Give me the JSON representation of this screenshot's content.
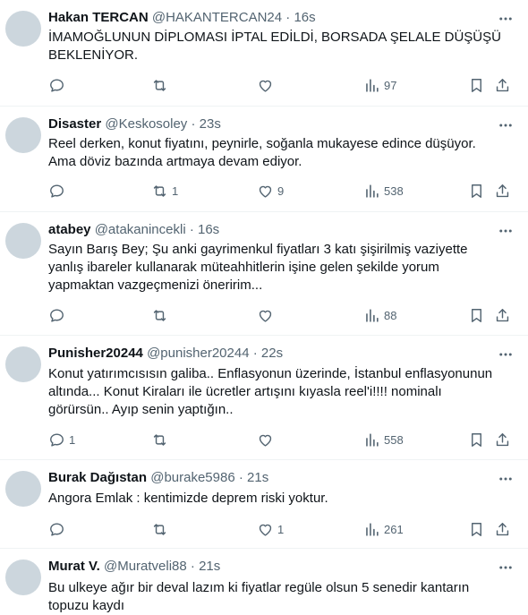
{
  "tweets": [
    {
      "name": "Hakan TERCAN",
      "handle": "@HAKANTERCAN24",
      "sep": "·",
      "time": "16s",
      "lines": [
        "İMAMOĞLUNUN DİPLOMASI İPTAL EDİLDİ, BORSADA ŞELALE DÜŞÜŞÜ",
        "BEKLENİYOR."
      ],
      "replies": "",
      "retweets": "",
      "likes": "",
      "views": "97"
    },
    {
      "name": "Disaster",
      "handle": "@Keskosoley",
      "sep": "·",
      "time": "23s",
      "lines": [
        "Reel derken, konut fiyatını, peynirle, soğanla mukayese edince düşüyor.",
        "Ama döviz bazında artmaya devam ediyor."
      ],
      "replies": "",
      "retweets": "1",
      "likes": "9",
      "views": "538"
    },
    {
      "name": "atabey",
      "handle": "@atakanincekli",
      "sep": "·",
      "time": "16s",
      "lines": [
        "Sayın Barış Bey; Şu anki gayrimenkul fiyatları 3 katı şişirilmiş vaziyette",
        "yanlış ibareler kullanarak müteahhitlerin işine gelen şekilde yorum",
        "yapmaktan vazgeçmenizi öneririm..."
      ],
      "replies": "",
      "retweets": "",
      "likes": "",
      "views": "88"
    },
    {
      "name": "Punisher20244",
      "handle": "@punisher20244",
      "sep": "·",
      "time": "22s",
      "lines": [
        "Konut yatırımcısısın galiba.. Enflasyonun üzerinde, İstanbul enflasyonunun",
        "altında... Konut Kiraları ile ücretler artışını kıyasla reel'i!!!! nominalı",
        "görürsün.. Ayıp senin yaptığın.."
      ],
      "replies": "1",
      "retweets": "",
      "likes": "",
      "views": "558"
    },
    {
      "name": "Burak Dağıstan",
      "handle": "@burake5986",
      "sep": "·",
      "time": "21s",
      "lines": [
        "Angora Emlak : kentimizde deprem riski yoktur."
      ],
      "replies": "",
      "retweets": "",
      "likes": "1",
      "views": "261"
    },
    {
      "name": "Murat V.",
      "handle": "@Muratveli88",
      "sep": "·",
      "time": "21s",
      "lines": [
        "Bu ulkeye ağır bir deval lazım ki fiyatlar regüle olsun 5 senedir kantarın",
        "topuzu kaydı"
      ],
      "replies": "",
      "retweets": "",
      "likes": "",
      "views": ""
    }
  ]
}
